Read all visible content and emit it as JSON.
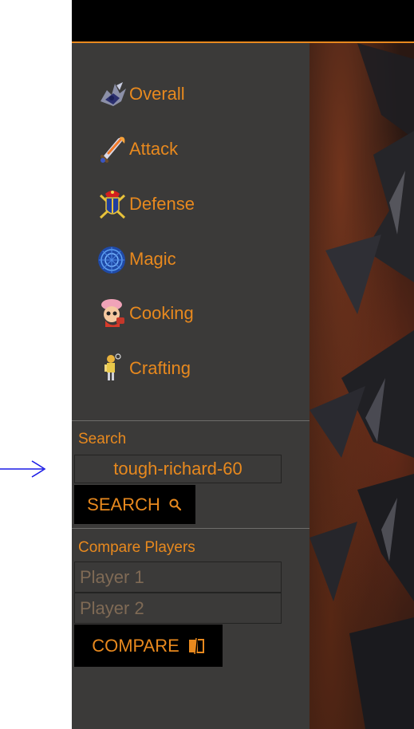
{
  "nav": {
    "items": [
      {
        "label": "Overall",
        "icon": "winged-dragon-icon"
      },
      {
        "label": "Attack",
        "icon": "flaming-sword-icon"
      },
      {
        "label": "Defense",
        "icon": "crest-shield-icon"
      },
      {
        "label": "Magic",
        "icon": "magic-orb-icon"
      },
      {
        "label": "Cooking",
        "icon": "chef-icon"
      },
      {
        "label": "Crafting",
        "icon": "crafter-icon"
      }
    ]
  },
  "search": {
    "label": "Search",
    "value": "tough-richard-60",
    "button_label": "SEARCH"
  },
  "compare": {
    "label": "Compare Players",
    "player1_placeholder": "Player 1",
    "player2_placeholder": "Player 2",
    "button_label": "COMPARE"
  },
  "colors": {
    "accent": "#e8891e",
    "sidebar": "#3b3a39",
    "topbar": "#000000",
    "annotation": "#1a1ae6"
  }
}
